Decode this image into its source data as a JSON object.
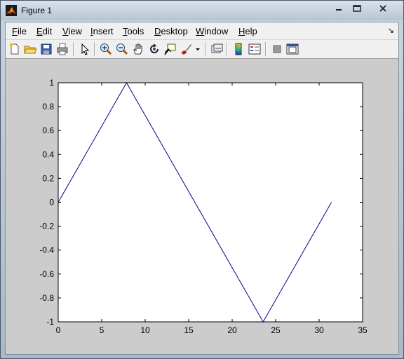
{
  "window": {
    "title": "Figure 1"
  },
  "menu": {
    "items": [
      "File",
      "Edit",
      "View",
      "Insert",
      "Tools",
      "Desktop",
      "Window",
      "Help"
    ]
  },
  "toolbar": {
    "buttons": [
      "new-figure-icon",
      "open-file-icon",
      "save-icon",
      "print-icon",
      "edit-plot-arrow-icon",
      "zoom-in-icon",
      "zoom-out-icon",
      "pan-hand-icon",
      "rotate-3d-icon",
      "data-cursor-icon",
      "brush-icon",
      "link-plot-icon",
      "colorbar-icon",
      "legend-icon",
      "hide-plot-tools-icon",
      "show-plot-tools-icon"
    ]
  },
  "chart_data": {
    "type": "line",
    "title": "",
    "xlabel": "",
    "ylabel": "",
    "xlim": [
      0,
      35
    ],
    "ylim": [
      -1,
      1
    ],
    "xticks": [
      0,
      5,
      10,
      15,
      20,
      25,
      30,
      35
    ],
    "yticks": [
      1,
      0.8,
      0.6,
      0.4,
      0.2,
      0,
      -0.2,
      -0.4,
      -0.6,
      -0.8,
      -1
    ],
    "xtick_labels": [
      "0",
      "5",
      "10",
      "15",
      "20",
      "25",
      "30",
      "35"
    ],
    "ytick_labels": [
      "1",
      "0.8",
      "0.6",
      "0.4",
      "0.2",
      "0",
      "-0.2",
      "-0.4",
      "-0.6",
      "-0.8",
      "-1"
    ],
    "grid": false,
    "series": [
      {
        "color": "#00008b",
        "x": [
          0,
          7.854,
          23.562,
          31.416
        ],
        "y": [
          0,
          1,
          -1,
          0
        ]
      }
    ]
  }
}
